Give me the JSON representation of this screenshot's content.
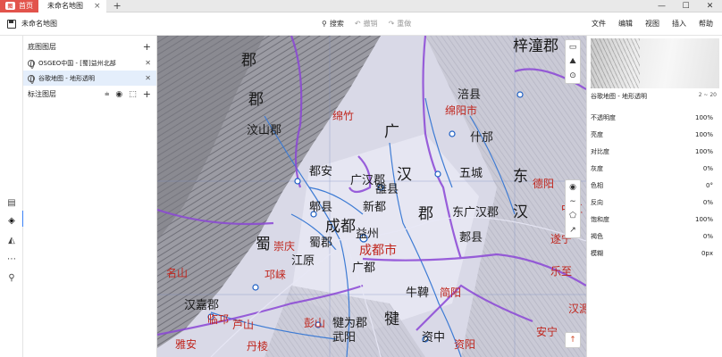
{
  "tabs": {
    "home_label": "首页",
    "home_logo": "图",
    "doc_label": "未命名地图",
    "close": "×",
    "new_tab": "+"
  },
  "window": {
    "minimize": "—",
    "maximize": "☐",
    "close": "✕"
  },
  "toolbar": {
    "doc_title": "未命名地图",
    "search": "搜索",
    "undo": "撤销",
    "redo": "重做",
    "menus": [
      "文件",
      "编辑",
      "视图",
      "插入",
      "帮助"
    ]
  },
  "layers": {
    "base_title": "底图图层",
    "base_items": [
      {
        "name": "OSGEO中国 - [蜀]益州北部"
      },
      {
        "name": "谷歌地图 - 地形透明"
      }
    ],
    "anno_title": "标注图层"
  },
  "properties": {
    "layer_name": "谷歌地图 - 地形透明",
    "zoom_range": "2 ~ 20",
    "items": [
      {
        "label": "不透明度",
        "value": "100%"
      },
      {
        "label": "亮度",
        "value": "100%"
      },
      {
        "label": "对比度",
        "value": "100%"
      },
      {
        "label": "灰度",
        "value": "0%"
      },
      {
        "label": "色相",
        "value": "0°"
      },
      {
        "label": "反向",
        "value": "0%"
      },
      {
        "label": "饱和度",
        "value": "100%"
      },
      {
        "label": "褐色",
        "value": "0%"
      },
      {
        "label": "模糊",
        "value": "0px"
      }
    ]
  },
  "map_labels": [
    {
      "text": "梓潼郡",
      "cls": "big"
    },
    {
      "text": "郡",
      "cls": "big"
    },
    {
      "text": "涪县",
      "cls": "mid"
    },
    {
      "text": "绵阳市",
      "cls": "red"
    },
    {
      "text": "郡",
      "cls": "big"
    },
    {
      "text": "汶山郡",
      "cls": "mid"
    },
    {
      "text": "绵竹",
      "cls": "red"
    },
    {
      "text": "广",
      "cls": "big"
    },
    {
      "text": "什邡",
      "cls": "mid"
    },
    {
      "text": "东",
      "cls": "big"
    },
    {
      "text": "都安",
      "cls": "mid"
    },
    {
      "text": "汉",
      "cls": "big"
    },
    {
      "text": "五城",
      "cls": "mid"
    },
    {
      "text": "广汉郡",
      "cls": "mid"
    },
    {
      "text": "雒县",
      "cls": "mid"
    },
    {
      "text": "新都",
      "cls": "mid"
    },
    {
      "text": "郡",
      "cls": "big"
    },
    {
      "text": "东广汉郡",
      "cls": "mid"
    },
    {
      "text": "汉",
      "cls": "big"
    },
    {
      "text": "郫县",
      "cls": "mid"
    },
    {
      "text": "成都",
      "cls": "big"
    },
    {
      "text": "益州",
      "cls": "mid"
    },
    {
      "text": "郪县",
      "cls": "mid"
    },
    {
      "text": "蜀",
      "cls": "big"
    },
    {
      "text": "崇庆",
      "cls": "red"
    },
    {
      "text": "蜀郡",
      "cls": "mid"
    },
    {
      "text": "成都市",
      "cls": "redbig"
    },
    {
      "text": "江原",
      "cls": "mid"
    },
    {
      "text": "广都",
      "cls": "mid"
    },
    {
      "text": "邛崃",
      "cls": "red"
    },
    {
      "text": "牛鞞",
      "cls": "mid"
    },
    {
      "text": "简阳",
      "cls": "red"
    },
    {
      "text": "汉嘉郡",
      "cls": "mid"
    },
    {
      "text": "临邛",
      "cls": "red"
    },
    {
      "text": "彭山",
      "cls": "red"
    },
    {
      "text": "犍为郡",
      "cls": "mid"
    },
    {
      "text": "犍",
      "cls": "big"
    },
    {
      "text": "武阳",
      "cls": "mid"
    },
    {
      "text": "资中",
      "cls": "mid"
    },
    {
      "text": "资阳",
      "cls": "red"
    },
    {
      "text": "安宁",
      "cls": "red"
    },
    {
      "text": "德阳",
      "cls": "red"
    },
    {
      "text": "中江",
      "cls": "red"
    },
    {
      "text": "遂宁",
      "cls": "red"
    },
    {
      "text": "乐至",
      "cls": "red"
    },
    {
      "text": "名山",
      "cls": "red"
    },
    {
      "text": "雅安",
      "cls": "red"
    },
    {
      "text": "芦山",
      "cls": "red"
    },
    {
      "text": "丹棱",
      "cls": "red"
    },
    {
      "text": "汉源",
      "cls": "red"
    }
  ],
  "map_controls": {
    "top": [
      "▭",
      "⛰",
      "⊙"
    ],
    "draw": [
      "◉",
      "∼",
      "⬠",
      "↗"
    ],
    "compass": "↑"
  }
}
